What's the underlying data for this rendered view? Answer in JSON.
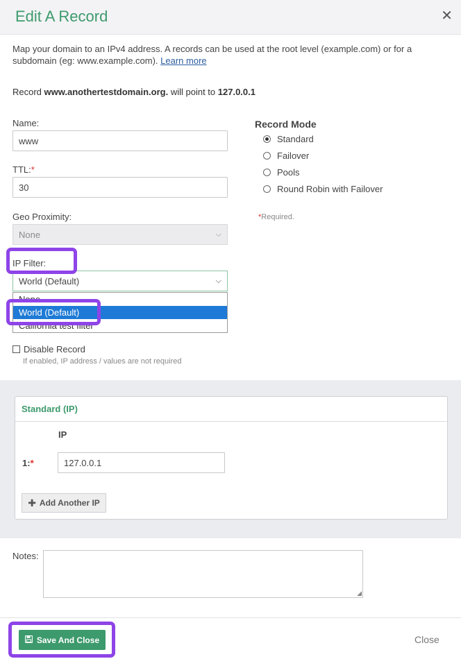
{
  "modal": {
    "title": "Edit A Record",
    "close_icon": "close-icon"
  },
  "description": {
    "text": "Map your domain to an IPv4 address. A records can be used at the root level (example.com) or for a subdomain (eg: www.example.com).",
    "link": "Learn more"
  },
  "record_summary": {
    "prefix": "Record",
    "domain": "www.anothertestdomain.org.",
    "middle": "will point to",
    "ip": "127.0.0.1"
  },
  "form": {
    "name_label": "Name:",
    "name_value": "www",
    "ttl_label": "TTL:",
    "required_mark": "*",
    "ttl_value": "30",
    "geo_label": "Geo Proximity:",
    "geo_value": "None",
    "ip_filter_label": "IP Filter:",
    "ip_filter_value": "World (Default)",
    "ip_filter_options": [
      "None",
      "World (Default)",
      "California test filter"
    ],
    "disable_label": "Disable Record",
    "disable_hint": "If enabled, IP address / values are not required"
  },
  "record_mode": {
    "title": "Record Mode",
    "options": [
      "Standard",
      "Failover",
      "Pools",
      "Round Robin with Failover"
    ],
    "selected": "Standard",
    "required_note": "Required."
  },
  "standard_panel": {
    "title": "Standard (IP)",
    "column_header": "IP",
    "row_index": "1:",
    "ip_value": "127.0.0.1",
    "add_button": "Add Another IP"
  },
  "notes": {
    "label": "Notes:",
    "value": ""
  },
  "footer": {
    "save_label": "Save And Close",
    "close_label": "Close"
  },
  "colors": {
    "brand_green": "#3d9a6c",
    "highlight_purple": "#8e44e8",
    "selected_blue": "#1e7ad6",
    "required_red": "#d9302c"
  }
}
